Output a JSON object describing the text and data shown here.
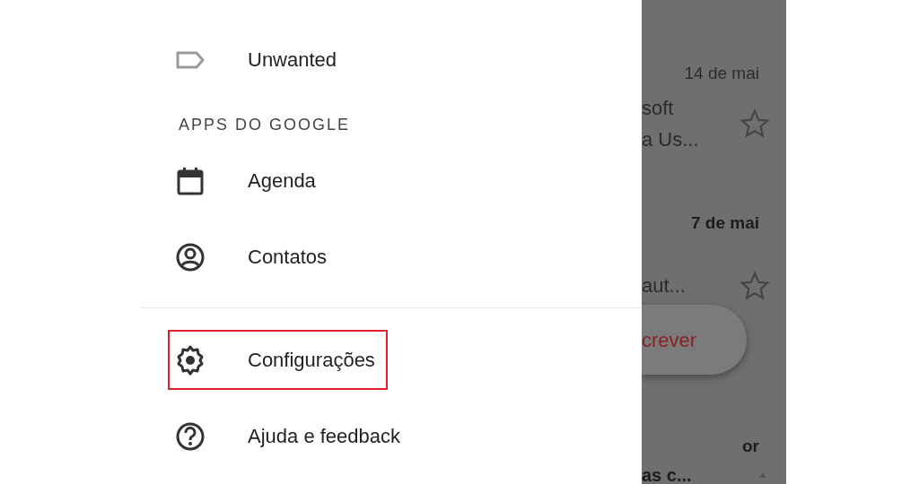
{
  "drawer": {
    "labels": [
      {
        "kind": "tag",
        "text": "Unwanted",
        "highlighted": false
      }
    ],
    "apps_header": "APPS DO GOOGLE",
    "apps": [
      {
        "kind": "calendar",
        "text": "Agenda",
        "highlighted": false
      },
      {
        "kind": "contacts",
        "text": "Contatos",
        "highlighted": false
      }
    ],
    "footer": [
      {
        "kind": "settings",
        "text": "Configurações",
        "highlighted": true
      },
      {
        "kind": "help",
        "text": "Ajuda e feedback",
        "highlighted": false
      }
    ]
  },
  "mail_list": {
    "rows": [
      {
        "date": "14 de mai",
        "unread": false,
        "lines": [
          "soft",
          "a Us..."
        ],
        "starred": false
      },
      {
        "date": "7 de mai",
        "unread": true,
        "lines": [
          "aut..."
        ],
        "starred": false
      },
      {
        "date": "or",
        "unread": true,
        "lines": [
          "as c..."
        ]
      }
    ]
  },
  "compose_button": {
    "label": "crever"
  }
}
